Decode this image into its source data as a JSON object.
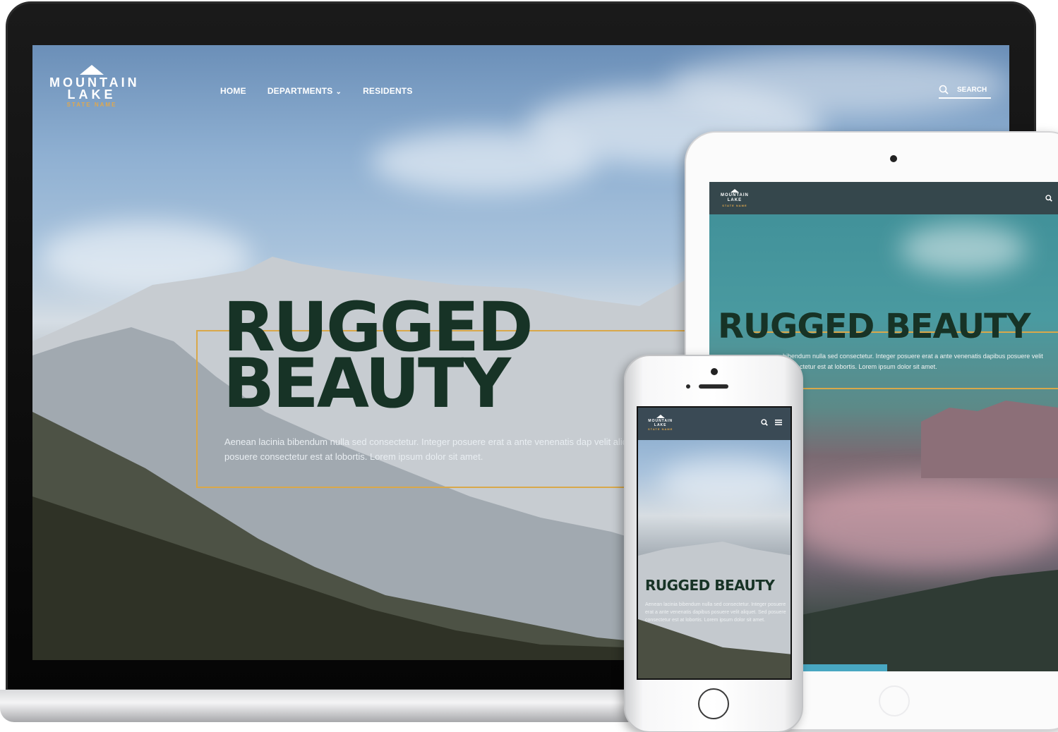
{
  "site": {
    "logo": {
      "line1": "MOUNTAIN",
      "line2": "LAKE",
      "sub": "STATE NAME"
    },
    "nav": [
      {
        "label": "HOME"
      },
      {
        "label": "DEPARTMENTS"
      },
      {
        "label": "RESIDENTS"
      }
    ],
    "search_label": "SEARCH",
    "hero": {
      "title_line1": "RUGGED",
      "title_line2": "BEAUTY",
      "title_single": "RUGGED BEAUTY",
      "text": "Aenean lacinia bibendum nulla sed consectetur. Integer posuere erat a ante venenatis dapibus posuere velit aliquet. Sed posuere consectetur est at lobortis. Lorem ipsum dolor sit amet.",
      "laptop_text": "Aenean lacinia bibendum nulla sed consectetur. Integer posuere erat a ante venenatis dap velit aliquet. Sed posuere consectetur est at lobortis. Lorem ipsum dolor sit amet.",
      "tablet_text": "bibendum nulla sed consectetur. Integer posuere erat a ante venenatis dapibus posuere velit consectetur est at lobortis. Lorem ipsum dolor sit amet."
    }
  },
  "colors": {
    "title": "#173326",
    "accent": "#d9a84a",
    "header_bg": "#35474c"
  },
  "icons": {
    "search": "search-icon",
    "chevron": "chevron-down-icon",
    "menu": "hamburger-menu-icon",
    "logo": "mountain-peak-icon"
  }
}
